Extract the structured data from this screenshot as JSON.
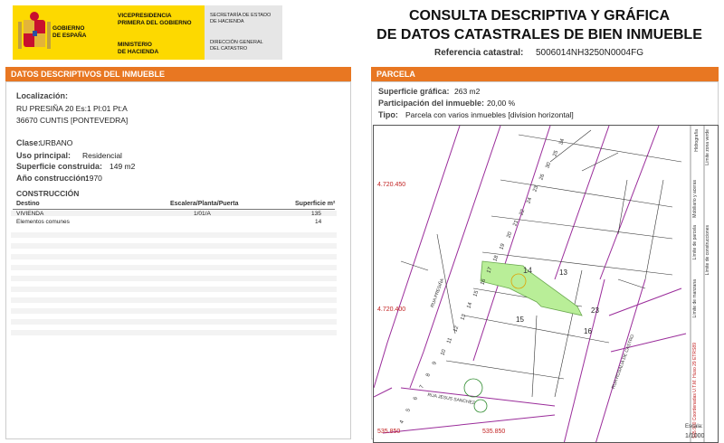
{
  "header": {
    "gov_line1": "GOBIERNO",
    "gov_line2": "DE ESPAÑA",
    "vice_line1": "VICEPRESIDENCIA",
    "vice_line2": "PRIMERA DEL GOBIERNO",
    "min_line1": "MINISTERIO",
    "min_line2": "DE HACIENDA",
    "sec_line1": "SECRETARÍA DE ESTADO",
    "sec_line2": "DE HACIENDA",
    "dir_line1": "DIRECCIÓN GENERAL",
    "dir_line2": "DEL CATASTRO",
    "title_line1": "CONSULTA DESCRIPTIVA Y GRÁFICA",
    "title_line2": "DE DATOS CATASTRALES DE BIEN INMUEBLE",
    "ref_label": "Referencia catastral:",
    "ref_value": "5006014NH3250N0004FG"
  },
  "left_panel": {
    "title": "DATOS DESCRIPTIVOS DEL INMUEBLE",
    "localizacion_label": "Localización:",
    "localizacion_line1": "RU PRESIÑA 20 Es:1 Pl:01 Pt:A",
    "localizacion_line2": "36670 CUNTIS [PONTEVEDRA]",
    "clase_label": "Clase:",
    "clase_value": "URBANO",
    "uso_label": "Uso principal:",
    "uso_value": "Residencial",
    "superficie_label": "Superficie construida:",
    "superficie_value": "149 m2",
    "anio_label": "Año construcción:",
    "anio_value": "1970",
    "construccion_title": "CONSTRUCCIÓN",
    "table_headers": [
      "Destino",
      "Escalera/Planta/Puerta",
      "Superficie m²"
    ],
    "rows": [
      {
        "destino": "VIVIENDA",
        "epp": "1/01/A",
        "sup": "135"
      },
      {
        "destino": "Elementos comunes",
        "epp": "",
        "sup": "14"
      }
    ]
  },
  "right_panel": {
    "title": "PARCELA",
    "sup_grafica_label": "Superficie gráfica:",
    "sup_grafica_value": "263 m2",
    "participacion_label": "Participación del inmueble:",
    "participacion_value": "20,00 %",
    "tipo_label": "Tipo:",
    "tipo_value": "Parcela con varios inmuebles [division horizontal]"
  },
  "map": {
    "parcel_number": "14",
    "block_numbers": [
      "13",
      "15",
      "16",
      "23"
    ],
    "coords": [
      "4.720.450",
      "4.720.400",
      "535.850",
      "535.850"
    ],
    "street_labels": [
      "RUA PRESIÑA",
      "RUA ROSALIA DE CASTRO",
      "RUA JESUS SANCHEZ"
    ],
    "house_numbers": [
      "34",
      "25",
      "30",
      "26",
      "23",
      "24",
      "22",
      "21",
      "20",
      "19",
      "18",
      "17",
      "16",
      "15",
      "14",
      "13",
      "12",
      "11",
      "10",
      "9",
      "8",
      "7",
      "6",
      "5",
      "4"
    ],
    "legend_items": [
      "Hidrografía",
      "Límite zona verde",
      "Mobiliario y aceras",
      "Límite de parcela",
      "Límite de construcciones",
      "Límite de manzana"
    ],
    "coord_note": "535.900 Coordenadas U.T.M. Huso 29 ETRS89",
    "scale_label": "Escala:",
    "scale_value": "1/1000",
    "colors": {
      "parcel_fill": "#b9ee98",
      "street_lines": "#9a2c9a",
      "coord_text": "#c22222"
    }
  }
}
